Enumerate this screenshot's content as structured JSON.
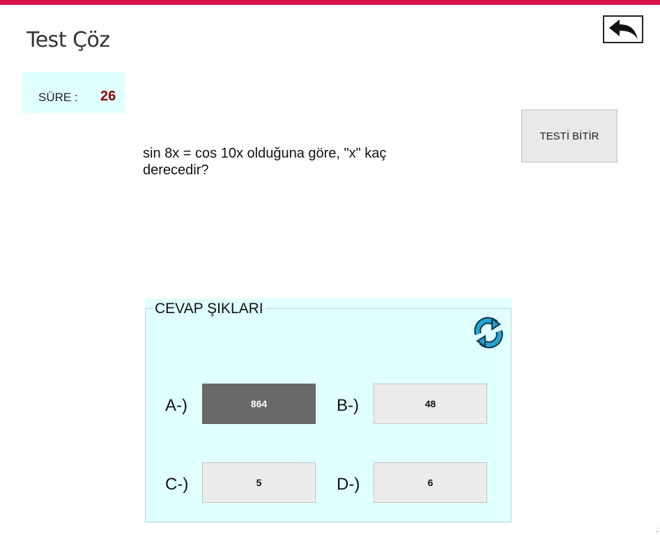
{
  "header": {
    "title": "Test Çöz",
    "accent_color": "#d6134b",
    "back_icon": "back-arrow-icon"
  },
  "timer": {
    "label": "SÜRE :",
    "value": "26"
  },
  "finish_button": {
    "label": "TESTİ BİTİR"
  },
  "question": {
    "text": "sin 8x = cos 10x olduğuna göre, \"x\" kaç derecedir?"
  },
  "answers": {
    "group_title": "CEVAP ŞIKLARI",
    "refresh_icon": "refresh-icon",
    "panel_color": "#e0ffff",
    "options": [
      {
        "label": "A-)",
        "value": "864",
        "selected": true
      },
      {
        "label": "B-)",
        "value": "48",
        "selected": false
      },
      {
        "label": "C-)",
        "value": "5",
        "selected": false
      },
      {
        "label": "D-)",
        "value": "6",
        "selected": false
      }
    ]
  },
  "status": {
    "resize_grip": ".:"
  }
}
